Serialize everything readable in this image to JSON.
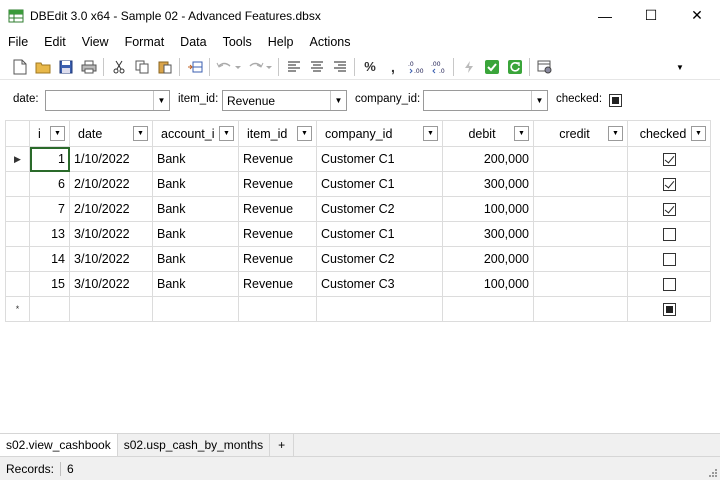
{
  "window": {
    "title": "DBEdit 3.0 x64 - Sample 02 - Advanced Features.dbsx",
    "minimize": "—",
    "maximize": "☐",
    "close": "✕"
  },
  "menu": [
    "File",
    "Edit",
    "View",
    "Format",
    "Data",
    "Tools",
    "Help",
    "Actions"
  ],
  "toolbar": {
    "icons": [
      "new-file-icon",
      "open-folder-icon",
      "save-icon",
      "print-icon",
      "cut-icon",
      "copy-icon",
      "paste-icon",
      "insert-row-icon",
      "undo-icon",
      "redo-icon",
      "align-left-icon",
      "align-center-icon",
      "align-right-icon",
      "percent-icon",
      "comma-icon",
      "increase-decimal-icon",
      "decrease-decimal-icon",
      "execute-icon",
      "commit-icon",
      "refresh-icon",
      "settings-icon"
    ],
    "percent": "%",
    "comma": ","
  },
  "filters": {
    "date_label": "date:",
    "date_value": "",
    "item_label": "item_id:",
    "item_value": "Revenue",
    "company_label": "company_id:",
    "company_value": "",
    "checked_label": "checked:",
    "checked_state": "indeterminate"
  },
  "grid": {
    "columns": [
      "id",
      "date",
      "account_id",
      "item_id",
      "company_id",
      "debit",
      "credit",
      "checked"
    ],
    "columns_display": [
      "i",
      "date",
      "account_i",
      "item_id",
      "company_id",
      "debit",
      "credit",
      "checked"
    ],
    "rows": [
      {
        "id": "1",
        "date": "1/10/2022",
        "account": "Bank",
        "item": "Revenue",
        "company": "Customer C1",
        "debit": "200,000",
        "credit": "",
        "checked": true
      },
      {
        "id": "6",
        "date": "2/10/2022",
        "account": "Bank",
        "item": "Revenue",
        "company": "Customer C1",
        "debit": "300,000",
        "credit": "",
        "checked": true
      },
      {
        "id": "7",
        "date": "2/10/2022",
        "account": "Bank",
        "item": "Revenue",
        "company": "Customer C2",
        "debit": "100,000",
        "credit": "",
        "checked": true
      },
      {
        "id": "13",
        "date": "3/10/2022",
        "account": "Bank",
        "item": "Revenue",
        "company": "Customer C1",
        "debit": "300,000",
        "credit": "",
        "checked": false
      },
      {
        "id": "14",
        "date": "3/10/2022",
        "account": "Bank",
        "item": "Revenue",
        "company": "Customer C2",
        "debit": "200,000",
        "credit": "",
        "checked": false
      },
      {
        "id": "15",
        "date": "3/10/2022",
        "account": "Bank",
        "item": "Revenue",
        "company": "Customer C3",
        "debit": "100,000",
        "credit": "",
        "checked": false
      }
    ],
    "current_row_marker": "▶",
    "new_row_marker": "*"
  },
  "sheet_tabs": [
    "s02.view_cashbook",
    "s02.usp_cash_by_months",
    "+"
  ],
  "status": {
    "records_label": "Records:",
    "records_value": "6"
  },
  "colors": {
    "active_cell_border": "#2a6a2a",
    "grid_line": "#dcdcdc",
    "chrome_bg": "#f0f0f0"
  }
}
